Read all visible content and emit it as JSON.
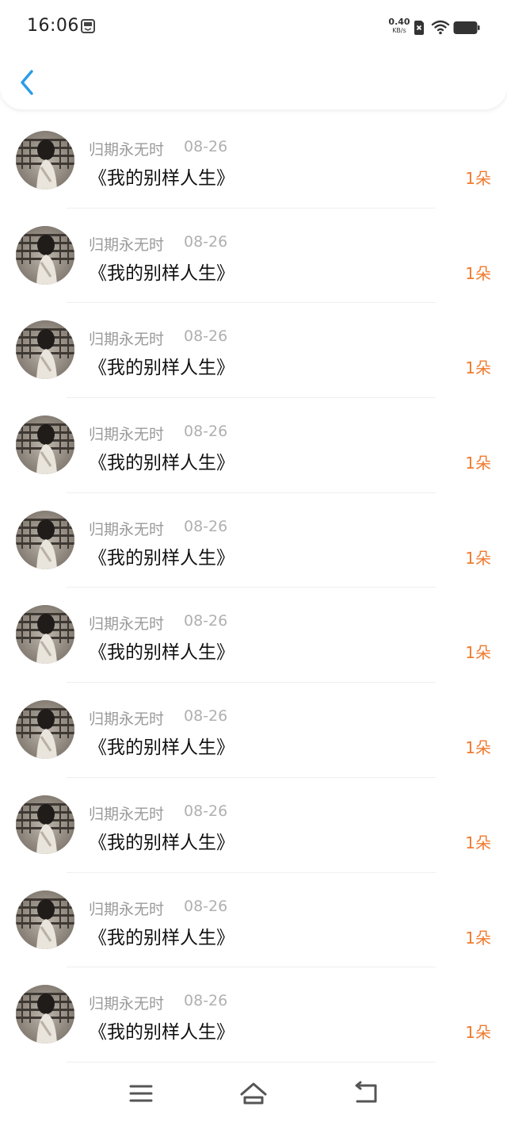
{
  "status_bar": {
    "time": "16:06",
    "net_speed_value": "0.40",
    "net_speed_unit": "KB/s",
    "icons": [
      "app-icon",
      "sim-icon",
      "wifi-icon",
      "battery-icon"
    ]
  },
  "header": {
    "back_icon": "chevron-left-icon",
    "accent_color": "#2a9be8"
  },
  "list": {
    "items": [
      {
        "user": "归期永无时",
        "date": "08-26",
        "title": "《我的别样人生》",
        "amount": "1朵"
      },
      {
        "user": "归期永无时",
        "date": "08-26",
        "title": "《我的别样人生》",
        "amount": "1朵"
      },
      {
        "user": "归期永无时",
        "date": "08-26",
        "title": "《我的别样人生》",
        "amount": "1朵"
      },
      {
        "user": "归期永无时",
        "date": "08-26",
        "title": "《我的别样人生》",
        "amount": "1朵"
      },
      {
        "user": "归期永无时",
        "date": "08-26",
        "title": "《我的别样人生》",
        "amount": "1朵"
      },
      {
        "user": "归期永无时",
        "date": "08-26",
        "title": "《我的别样人生》",
        "amount": "1朵"
      },
      {
        "user": "归期永无时",
        "date": "08-26",
        "title": "《我的别样人生》",
        "amount": "1朵"
      },
      {
        "user": "归期永无时",
        "date": "08-26",
        "title": "《我的别样人生》",
        "amount": "1朵"
      },
      {
        "user": "归期永无时",
        "date": "08-26",
        "title": "《我的别样人生》",
        "amount": "1朵"
      },
      {
        "user": "归期永无时",
        "date": "08-26",
        "title": "《我的别样人生》",
        "amount": "1朵"
      }
    ],
    "amount_color": "#f07a2e"
  },
  "nav_bar": {
    "icons": [
      "menu-icon",
      "home-icon",
      "back-icon"
    ]
  }
}
